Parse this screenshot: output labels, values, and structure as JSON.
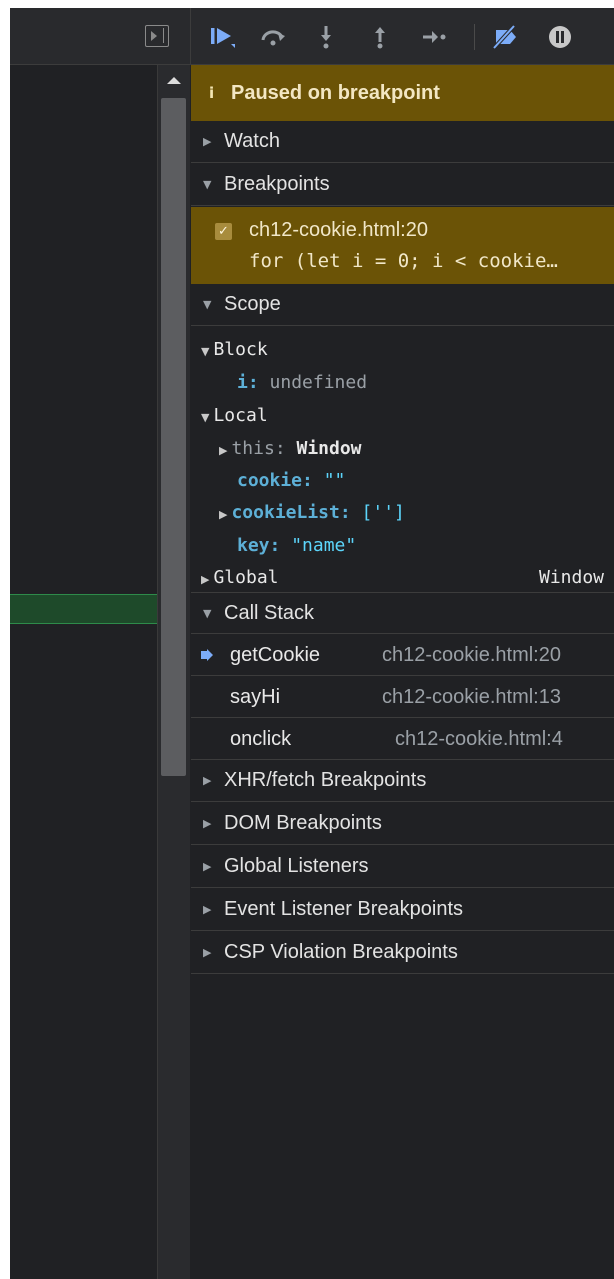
{
  "banner": {
    "icon": "i",
    "text": "Paused on breakpoint"
  },
  "sections": {
    "watch": "Watch",
    "breakpoints": "Breakpoints",
    "scope": "Scope",
    "call_stack": "Call Stack",
    "xhr": "XHR/fetch Breakpoints",
    "dom": "DOM Breakpoints",
    "global_listeners": "Global Listeners",
    "event_listener": "Event Listener Breakpoints",
    "csp": "CSP Violation Breakpoints"
  },
  "breakpoint": {
    "checkmark": "✓",
    "file": "ch12-cookie.html:20",
    "code": "for (let i = 0; i < cookie…"
  },
  "scope": {
    "block": {
      "label": "Block",
      "i_key": "i:",
      "i_value": "undefined"
    },
    "local": {
      "label": "Local",
      "this_key": "this:",
      "this_value": "Window",
      "cookie_key": "cookie:",
      "cookie_value": "\"\"",
      "cookielist_key": "cookieList:",
      "cookielist_value": "['']",
      "key_key": "key:",
      "key_value": "\"name\""
    },
    "global": {
      "label": "Global",
      "value": "Window"
    }
  },
  "call_stack": [
    {
      "fn": "getCookie",
      "loc": "ch12-cookie.html:20"
    },
    {
      "fn": "sayHi",
      "loc": "ch12-cookie.html:13"
    },
    {
      "fn": "onclick",
      "loc": "ch12-cookie.html:4"
    }
  ],
  "arrows": {
    "collapsed": "▶",
    "expanded": "▼"
  },
  "colors": {
    "banner_bg": "#6b5306",
    "panel_bg": "#202124",
    "current_line": "#1e4a2a",
    "accent_blue": "#7cacf8"
  }
}
